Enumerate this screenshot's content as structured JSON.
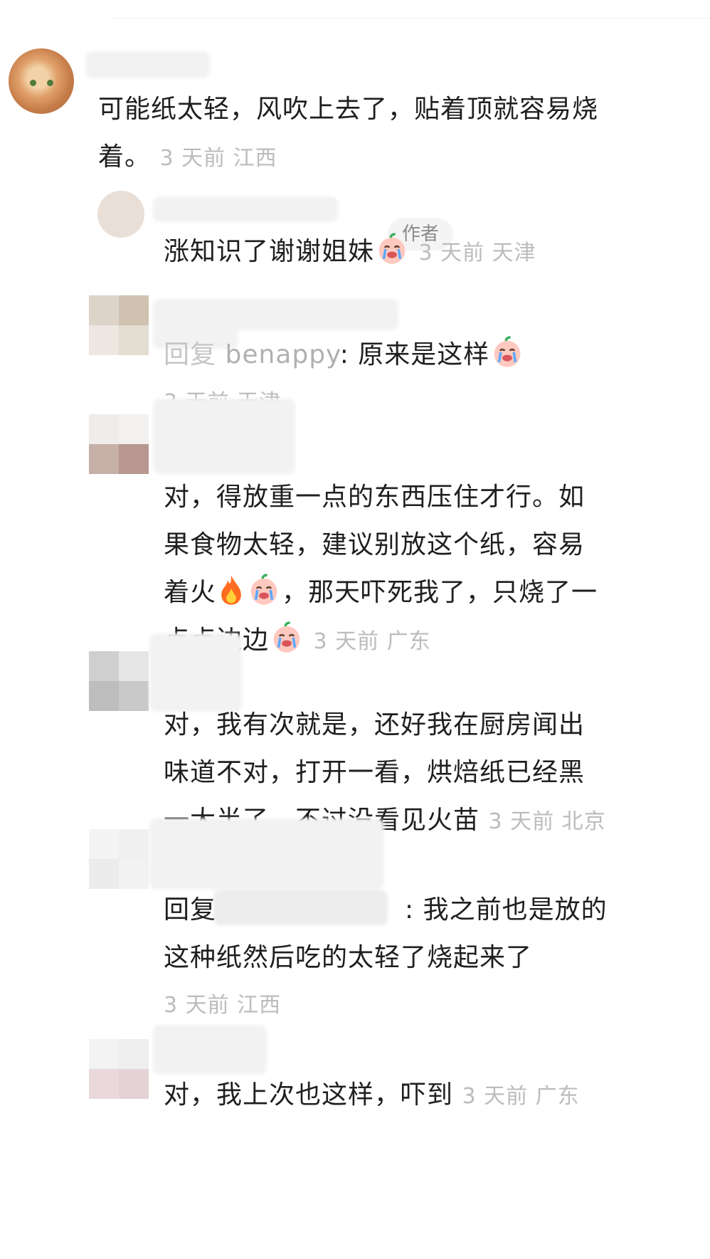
{
  "comments": [
    {
      "text": "可能纸太轻，风吹上去了，贴着顶就容易烧着。",
      "line1": "可能纸太轻，风吹上去了，贴着顶就容易烧",
      "line2": "着。",
      "meta": "3 天前 江西"
    },
    {
      "badge": "作者",
      "text": "涨知识了谢谢姐妹",
      "emoji": "crying-face",
      "meta": "3 天前 天津"
    },
    {
      "reply_prefix": "回复",
      "reply_to": "benappy",
      "text": ": 原来是这样",
      "emoji": "crying-face",
      "meta": "3 天前 天津"
    },
    {
      "line1": "对，得放重一点的东西压住才行。如",
      "line2": "果食物太轻，建议别放这个纸，容易",
      "line3a": "着火",
      "line3b": "，那天吓死我了，只烧了一",
      "line4": "点点边边",
      "emojis": [
        "fire",
        "crying-face"
      ],
      "meta": "3 天前 广东"
    },
    {
      "line1": "对，我有次就是，还好我在厨房闻出",
      "line2": "味道不对，打开一看，烘焙纸已经黑",
      "line3": "一大半了，不过没看见火苗",
      "meta": "3 天前 北京"
    },
    {
      "reply_prefix": "回复",
      "line1b": ": 我之前也是放的",
      "line2": "这种纸然后吃的太轻了烧起来了",
      "meta": "3 天前 江西"
    },
    {
      "text": "对，我上次也这样，吓到",
      "meta": "3 天前 广东"
    }
  ],
  "colors": {
    "meta": "#bcbcbc",
    "text": "#1f1f1f",
    "badge_bg": "#f4f4f4"
  }
}
